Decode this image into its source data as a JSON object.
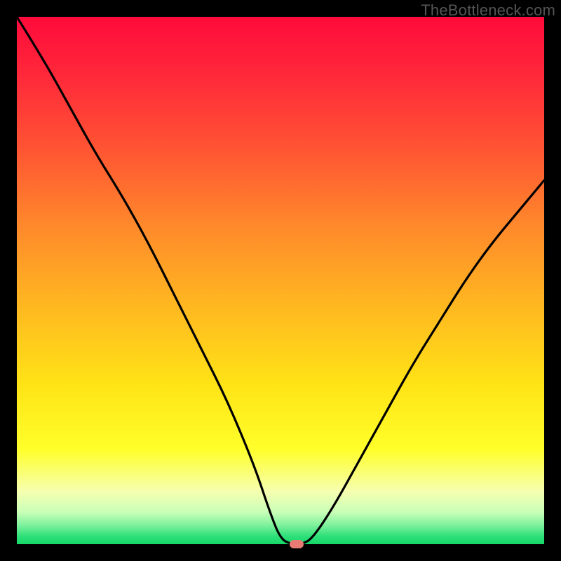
{
  "watermark": "TheBottleneck.com",
  "colors": {
    "gradient_stops": [
      {
        "offset": 0.0,
        "color": "#ff0a3b"
      },
      {
        "offset": 0.12,
        "color": "#ff2b3a"
      },
      {
        "offset": 0.25,
        "color": "#ff5433"
      },
      {
        "offset": 0.4,
        "color": "#ff8a2b"
      },
      {
        "offset": 0.55,
        "color": "#ffb820"
      },
      {
        "offset": 0.7,
        "color": "#ffe416"
      },
      {
        "offset": 0.82,
        "color": "#ffff2a"
      },
      {
        "offset": 0.9,
        "color": "#f6ffb0"
      },
      {
        "offset": 0.94,
        "color": "#c8ffb8"
      },
      {
        "offset": 0.965,
        "color": "#7af09a"
      },
      {
        "offset": 0.985,
        "color": "#2ee07a"
      },
      {
        "offset": 1.0,
        "color": "#16d868"
      }
    ],
    "curve": "#000000",
    "marker": "#e97a74",
    "background_frame": "#000000"
  },
  "chart_data": {
    "type": "line",
    "title": "",
    "xlabel": "",
    "ylabel": "",
    "xlim": [
      0,
      100
    ],
    "ylim": [
      0,
      100
    ],
    "annotations": [
      "TheBottleneck.com"
    ],
    "series": [
      {
        "name": "bottleneck-curve",
        "x": [
          0,
          5,
          10,
          15,
          20,
          25,
          30,
          35,
          40,
          45,
          48,
          50,
          52,
          54,
          56,
          60,
          65,
          70,
          75,
          80,
          85,
          90,
          95,
          100
        ],
        "values": [
          100,
          92,
          83,
          74,
          66,
          57,
          47,
          37,
          27,
          15,
          6,
          1,
          0,
          0,
          1,
          7,
          16,
          25,
          34,
          42,
          50,
          57,
          63,
          69
        ]
      }
    ],
    "marker": {
      "x": 53,
      "y": 0
    },
    "legend": false,
    "grid": false
  }
}
